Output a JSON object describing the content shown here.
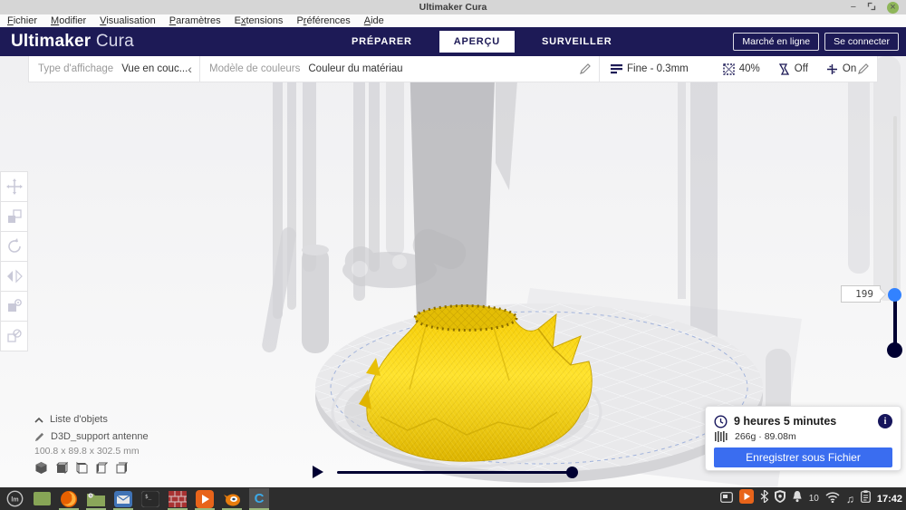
{
  "window": {
    "title": "Ultimaker Cura",
    "controls": {
      "minimize": "−",
      "close": "×"
    }
  },
  "menubar": {
    "items": [
      {
        "pre": "",
        "m": "F",
        "post": "ichier"
      },
      {
        "pre": "",
        "m": "M",
        "post": "odifier"
      },
      {
        "pre": "",
        "m": "V",
        "post": "isualisation"
      },
      {
        "pre": "",
        "m": "P",
        "post": "aramètres"
      },
      {
        "pre": "E",
        "m": "x",
        "post": "tensions"
      },
      {
        "pre": "P",
        "m": "r",
        "post": "éférences"
      },
      {
        "pre": "",
        "m": "A",
        "post": "ide"
      }
    ]
  },
  "header": {
    "brand_bold": "Ultimaker",
    "brand_light": "Cura",
    "tabs": [
      {
        "label": "PRÉPARER"
      },
      {
        "label": "APERÇU"
      },
      {
        "label": "SURVEILLER"
      }
    ],
    "active_tab": "APERÇU",
    "marketplace_button": "Marché en ligne",
    "sign_in_button": "Se connecter"
  },
  "toolbar": {
    "display_type_label": "Type d'affichage",
    "display_type_value": "Vue en couc...",
    "collapse_chevron": "‹",
    "color_scheme_label": "Modèle de couleurs",
    "color_scheme_value": "Couleur du matériau",
    "profile_value": "Fine - 0.3mm",
    "infill_value": "40%",
    "support_value": "Off",
    "adhesion_value": "On"
  },
  "layer_slider": {
    "current_layer": "199"
  },
  "object_list": {
    "toggle_label": "Liste d'objets",
    "object_name": "D3D_support antenne",
    "object_dimensions": "100.8 x 89.8 x 302.5 mm"
  },
  "stats": {
    "print_time": "9 heures 5 minutes",
    "material_usage": "266g · 89.08m",
    "save_button": "Enregistrer sous Fichier",
    "info_glyph": "i"
  },
  "taskbar": {
    "clock": "17:42",
    "notification_count": "10",
    "music_note_glyph": "♫",
    "terminal_glyph": "$_",
    "mint_glyph": "lm",
    "cura_glyph": "C"
  },
  "colors": {
    "header_navy": "#1d1a56",
    "action_blue": "#3a6df0",
    "handle_blue": "#3282ff",
    "slider_navy": "#000032",
    "model_yellow": "#f7cf08",
    "close_green": "#8fb65a",
    "running_indicator_green": "#9ab87c"
  }
}
